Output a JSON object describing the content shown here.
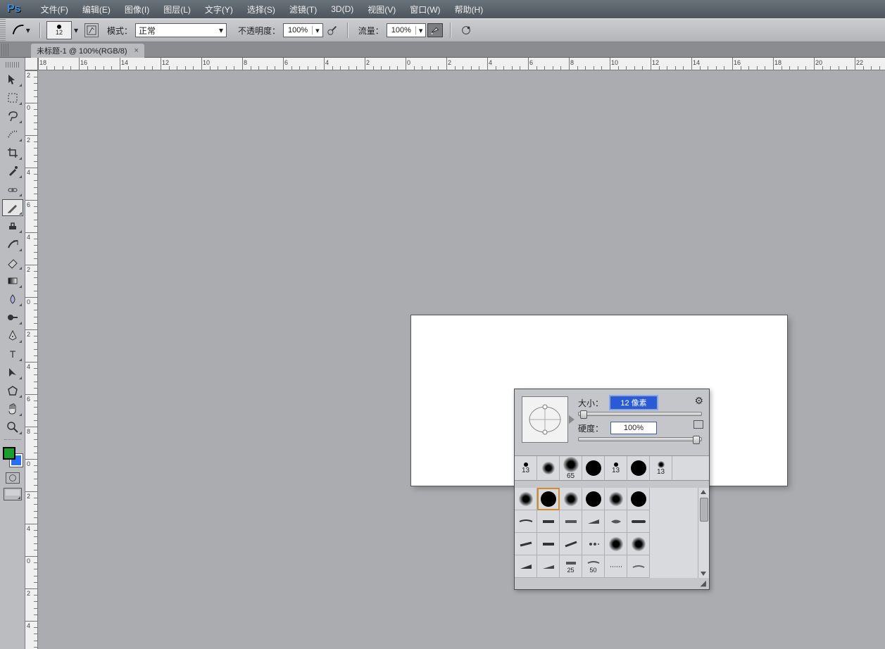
{
  "app": {
    "logo": "Ps"
  },
  "menu": {
    "file": "文件(F)",
    "edit": "编辑(E)",
    "image": "图像(I)",
    "layer": "图层(L)",
    "type": "文字(Y)",
    "select": "选择(S)",
    "filter": "滤镜(T)",
    "three_d": "3D(D)",
    "view": "视图(V)",
    "window": "窗口(W)",
    "help": "帮助(H)"
  },
  "options": {
    "brush_size": "12",
    "mode_label": "模式：",
    "mode_value": "正常",
    "opacity_label": "不透明度：",
    "opacity_value": "100%",
    "flow_label": "流量：",
    "flow_value": "100%"
  },
  "tabs": {
    "doc_title": "未标题-1 @ 100%(RGB/8)",
    "close": "×"
  },
  "ruler": {
    "h_left": "18",
    "h_labels": [
      "18",
      "16",
      "14",
      "12",
      "10",
      "8",
      "6",
      "4",
      "2",
      "0",
      "2",
      "4",
      "6",
      "8",
      "10",
      "12",
      "14",
      "16",
      "18",
      "20",
      "22"
    ],
    "v_labels": [
      "2",
      "0",
      "2",
      "4",
      "6",
      "4",
      "2",
      "0",
      "2",
      "4",
      "6",
      "8",
      "0",
      "2",
      "4",
      "0",
      "2",
      "4"
    ]
  },
  "popup": {
    "size_label": "大小：",
    "size_value": "12 像素",
    "hardness_label": "硬度：",
    "hardness_value": "100%",
    "gear": "⚙",
    "presets": [
      {
        "size": "13",
        "type": "hard"
      },
      {
        "size": "",
        "type": "soft"
      },
      {
        "size": "65",
        "type": "soft-big"
      },
      {
        "size": "",
        "type": "hard-big"
      },
      {
        "size": "13",
        "type": "hard-small"
      },
      {
        "size": "",
        "type": "hard-big"
      },
      {
        "size": "13",
        "type": "soft-small"
      }
    ],
    "grid_labels": {
      "r1": [
        "",
        "",
        "",
        "",
        "",
        ""
      ],
      "r4": [
        "",
        "",
        "25",
        "50",
        "",
        ""
      ]
    }
  },
  "colors": {
    "fg": "#17a02b",
    "bg": "#2a6df7"
  }
}
